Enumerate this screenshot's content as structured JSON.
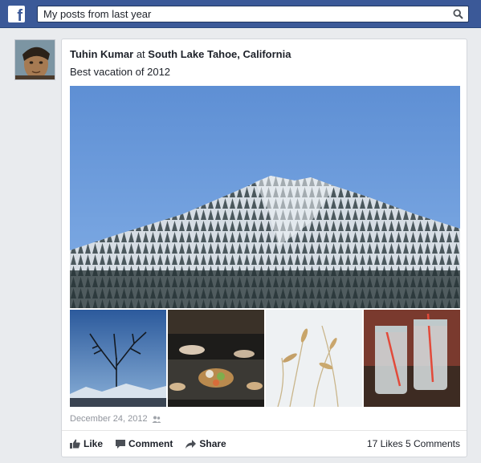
{
  "header": {
    "logo_letter": "f",
    "search_value": "My posts from last year",
    "search_icon": "search-icon"
  },
  "post": {
    "author": "Tuhin Kumar",
    "at_word": "at",
    "location": "South Lake Tahoe, California",
    "caption": "Best vacation of 2012",
    "date": "December 24, 2012",
    "audience_icon": "friends-icon"
  },
  "actions": {
    "like_label": "Like",
    "comment_label": "Comment",
    "share_label": "Share"
  },
  "stats": {
    "likes": "17 Likes",
    "comments": "5 Comments"
  },
  "colors": {
    "brand": "#3b5998",
    "background": "#e9ebee",
    "sky": "#6a9ad6"
  }
}
